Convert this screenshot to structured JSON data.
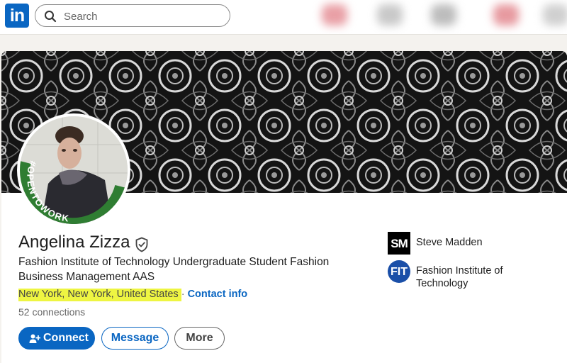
{
  "nav": {
    "logo_text": "in",
    "search_placeholder": "Search"
  },
  "profile": {
    "name": "Angelina Zizza",
    "badge_text": "#OPENTOWORK",
    "headline": "Fashion Institute of Technology Undergraduate Student Fashion Business Management AAS",
    "location": "New York, New York, United States",
    "separator": "·",
    "contact_info": "Contact info",
    "connections": "52 connections"
  },
  "actions": {
    "connect": "Connect",
    "message": "Message",
    "more": "More"
  },
  "experience": [
    {
      "logo_text": "SM",
      "label": "Steve Madden"
    },
    {
      "logo_text": "FIT",
      "label": "Fashion Institute of Technology"
    }
  ],
  "colors": {
    "brand": "#0a66c2",
    "open_to_work": "#2f7d32",
    "highlight": "#eef542"
  }
}
